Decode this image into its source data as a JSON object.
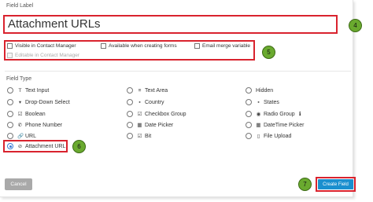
{
  "field_label": {
    "caption": "Field Label",
    "value": "Attachment URLs"
  },
  "options": {
    "visible_in_contact_manager": "Visible in Contact Manager",
    "available_when_creating_forms": "Available when creating forms",
    "email_merge_variable": "Email merge variable",
    "editable_in_contact_manager": "Editable in Contact Manager"
  },
  "field_type": {
    "caption": "Field Type",
    "col1": [
      {
        "icon": "T",
        "label": "Text Input"
      },
      {
        "icon": "▾",
        "label": "Drop-Down Select"
      },
      {
        "icon": "☑",
        "label": "Boolean"
      },
      {
        "icon": "✆",
        "label": "Phone Number"
      },
      {
        "icon": "🔗",
        "label": "URL"
      },
      {
        "icon": "⊘",
        "label": "Attachment URL"
      }
    ],
    "col2": [
      {
        "icon": "≡",
        "label": "Text Area"
      },
      {
        "icon": "▪",
        "label": "Country"
      },
      {
        "icon": "☑",
        "label": "Checkbox Group"
      },
      {
        "icon": "▦",
        "label": "Date Picker"
      },
      {
        "icon": "☑",
        "label": "Bit"
      }
    ],
    "col3": [
      {
        "icon": "",
        "label": "Hidden"
      },
      {
        "icon": "▪",
        "label": "States"
      },
      {
        "icon": "◉",
        "label": "Radio Group",
        "info": "ℹ"
      },
      {
        "icon": "▦",
        "label": "DateTime Picker"
      },
      {
        "icon": "▯",
        "label": "File Upload"
      }
    ]
  },
  "badges": {
    "b4": "4",
    "b5": "5",
    "b6": "6",
    "b7": "7"
  },
  "buttons": {
    "cancel": "Cancel",
    "create": "Create Field"
  },
  "colors": {
    "highlight": "#d9232e",
    "badge": "#6aaa2f",
    "primary": "#1a8fcf",
    "secondary": "#a9a9a9"
  }
}
